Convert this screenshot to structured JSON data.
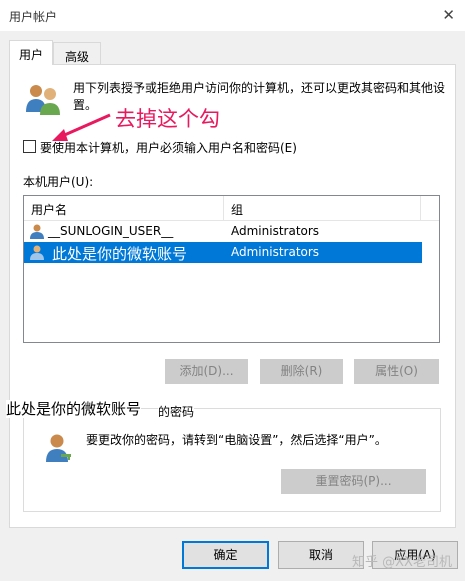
{
  "window": {
    "title": "用户帐户",
    "close_glyph": "✕"
  },
  "tabs": [
    {
      "label": "用户",
      "active": true
    },
    {
      "label": "高级",
      "active": false
    }
  ],
  "intro_text": "用下列表授予或拒绝用户访问你的计算机，还可以更改其密码和其他设置。",
  "annotation": {
    "text": "去掉这个勾",
    "color": "#e8195f"
  },
  "require_login_checkbox": {
    "label": "要使用本计算机，用户必须输入用户名和密码(E)",
    "checked": false
  },
  "local_users": {
    "label": "本机用户(U):",
    "columns": [
      "用户名",
      "组"
    ],
    "rows": [
      {
        "name": "__SUNLOGIN_USER__",
        "group": "Administrators",
        "selected": false
      },
      {
        "name": "此处是你的微软账号",
        "group": "Administrators",
        "selected": true
      }
    ]
  },
  "buttons": {
    "add": "添加(D)...",
    "remove": "删除(R)",
    "properties": "属性(O)"
  },
  "password_section": {
    "title_main": "此处是你的微软账号",
    "title_suffix": "的密码",
    "description": "要更改你的密码，请转到“电脑设置”，然后选择“用户”。",
    "reset_button": "重置密码(P)..."
  },
  "footer": {
    "ok": "确定",
    "cancel": "取消",
    "apply": "应用(A)"
  },
  "watermark": "知乎 @XX老司机",
  "colors": {
    "selection": "#0078d7",
    "accent": "#0078d7"
  },
  "icons": [
    "close-icon",
    "users-icon",
    "arrow-icon",
    "user-icon",
    "key-icon"
  ]
}
